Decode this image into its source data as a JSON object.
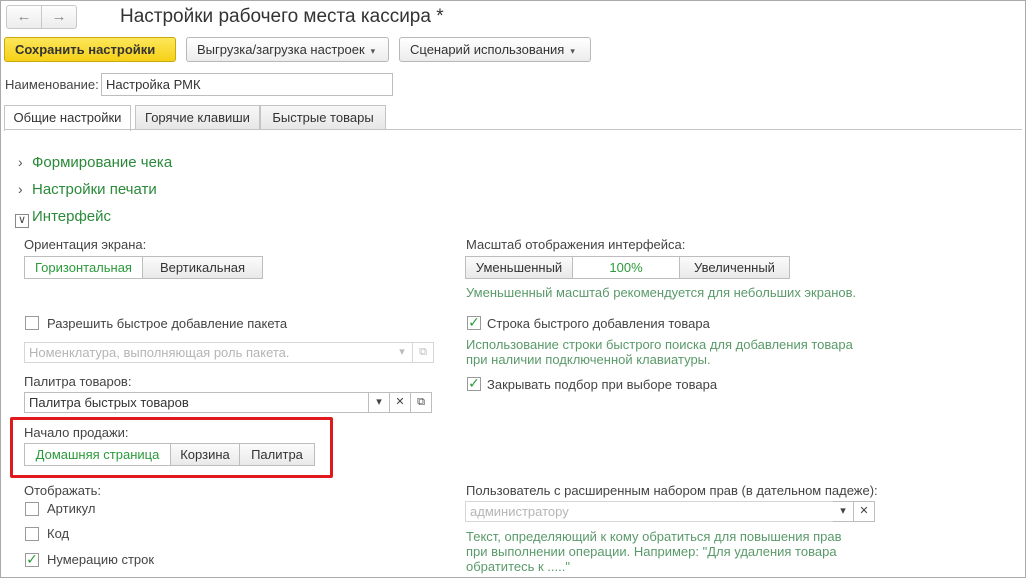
{
  "window": {
    "title": "Настройки рабочего места кассира *",
    "back_icon": "←",
    "forward_icon": "→"
  },
  "toolbar": {
    "save_label": "Сохранить настройки",
    "export_label": "Выгрузка/загрузка настроек",
    "scenario_label": "Сценарий использования",
    "dropdown_glyph": "▾"
  },
  "name_field": {
    "label": "Наименование:",
    "value": "Настройка РМК"
  },
  "tabs": [
    {
      "label": "Общие настройки",
      "active": true
    },
    {
      "label": "Горячие клавиши",
      "active": false
    },
    {
      "label": "Быстрые товары",
      "active": false
    }
  ],
  "groups": {
    "receipt": {
      "label": "Формирование чека",
      "state": "collapsed"
    },
    "print": {
      "label": "Настройки печати",
      "state": "collapsed"
    },
    "interface": {
      "label": "Интерфейс",
      "state": "expanded"
    }
  },
  "chevron_right": "›",
  "chevron_down": "∨",
  "orientation": {
    "label": "Ориентация экрана:",
    "options": [
      "Горизонтальная",
      "Вертикальная"
    ],
    "selected": "Горизонтальная"
  },
  "scale": {
    "label": "Масштаб отображения интерфейса:",
    "options": [
      "Уменьшенный",
      "100%",
      "Увеличенный"
    ],
    "selected": "100%",
    "hint": "Уменьшенный масштаб рекомендуется для небольших экранов."
  },
  "quick_package": {
    "label": "Разрешить быстрое добавление пакета",
    "checked": false,
    "placeholder": "Номенклатура, выполняющая роль пакета."
  },
  "quick_add_row": {
    "label": "Строка быстрого добавления товара",
    "checked": true,
    "hint_line1": "Использование строки быстрого поиска для добавления товара",
    "hint_line2": "при наличии подключенной клавиатуры."
  },
  "palette": {
    "label": "Палитра товаров:",
    "value": "Палитра быстрых товаров"
  },
  "close_selection": {
    "label": "Закрывать подбор при выборе товара",
    "checked": true
  },
  "sale_start": {
    "label": "Начало продажи:",
    "options": [
      "Домашняя страница",
      "Корзина",
      "Палитра"
    ],
    "selected": "Домашняя страница"
  },
  "display": {
    "label": "Отображать:",
    "items": [
      {
        "label": "Артикул",
        "checked": false
      },
      {
        "label": "Код",
        "checked": false
      },
      {
        "label": "Нумерацию строк",
        "checked": true
      }
    ]
  },
  "privileged_user": {
    "label": "Пользователь с расширенным набором прав (в дательном падеже):",
    "placeholder": "администратору",
    "hint_line1": "Текст, определяющий к кому обратиться для повышения прав",
    "hint_line2": "при выполнении операции. Например: \"Для удаления товара",
    "hint_line3": "обратитесь к .....\""
  },
  "icons": {
    "check": "✓",
    "clear": "✕",
    "dropdown": "▾",
    "open": "⧉"
  },
  "colors": {
    "accent_green": "#2a8a3a",
    "primary_yellow": "#f5d117",
    "highlight_red": "#e0191e"
  }
}
